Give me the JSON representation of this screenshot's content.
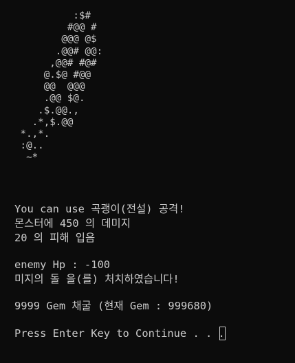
{
  "art": {
    "lines": [
      "          :$#",
      "         #@@ #",
      "        @@@ @$",
      "       .@@# @@:",
      "      ,@@# #@#",
      "     @.$@ #@@",
      "     @@  @@@",
      "     .@@ $@.",
      "    .$.@@.,",
      "   .*,$.@@",
      " *.,*.",
      " :@..",
      "  ~*"
    ]
  },
  "messages": {
    "attack": "You can use 곡괭이(전설) 공격!",
    "damage_dealt": "몬스터에 450 의 데미지",
    "damage_taken": "20 의 피해 입음",
    "enemy_hp": "enemy Hp : -100",
    "defeated": "미지의 돌 을(를) 처치하였습니다!",
    "gem_reward": "9999 Gem 채굴 (현재 Gem : 999680)",
    "prompt": "Press Enter Key to Continue . . ."
  }
}
